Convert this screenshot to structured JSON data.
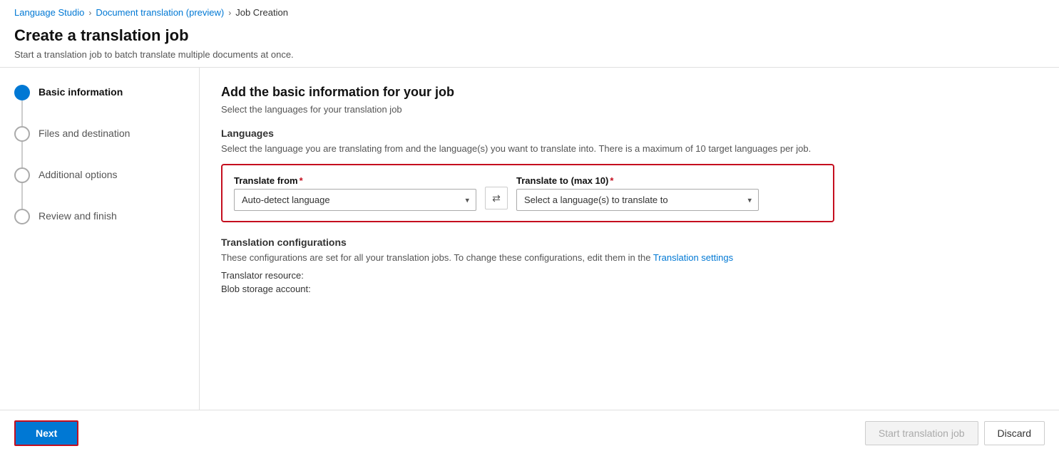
{
  "breadcrumb": {
    "items": [
      {
        "label": "Language Studio",
        "href": "#"
      },
      {
        "label": "Document translation (preview)",
        "href": "#"
      },
      {
        "label": "Job Creation",
        "href": null
      }
    ],
    "separators": [
      ">",
      ">"
    ]
  },
  "page": {
    "title": "Create a translation job",
    "subtitle": "Start a translation job to batch translate multiple documents at once."
  },
  "sidebar": {
    "steps": [
      {
        "label": "Basic information",
        "state": "active",
        "number": ""
      },
      {
        "label": "Files and destination",
        "state": "inactive",
        "number": ""
      },
      {
        "label": "Additional options",
        "state": "inactive",
        "number": ""
      },
      {
        "label": "Review and finish",
        "state": "inactive",
        "number": ""
      }
    ]
  },
  "content": {
    "section_title": "Add the basic information for your job",
    "section_subtitle": "Select the languages for your translation job",
    "languages_label": "Languages",
    "languages_desc": "Select the language you are translating from and the language(s) you want to translate into. There is a maximum of 10 target languages per job.",
    "translate_from_label": "Translate from",
    "translate_from_required": "*",
    "translate_from_value": "Auto-detect language",
    "translate_to_label": "Translate to (max 10)",
    "translate_to_required": "*",
    "translate_to_placeholder": "Select a language(s) to translate to",
    "swap_icon": "⇄",
    "configs_title": "Translation configurations",
    "configs_desc_part1": "These configurations are set for all your translation jobs. To change these configurations, edit them in the",
    "configs_link_label": "Translation settings",
    "translator_resource_label": "Translator resource:",
    "blob_storage_label": "Blob storage account:"
  },
  "footer": {
    "next_label": "Next",
    "start_label": "Start translation job",
    "discard_label": "Discard"
  }
}
